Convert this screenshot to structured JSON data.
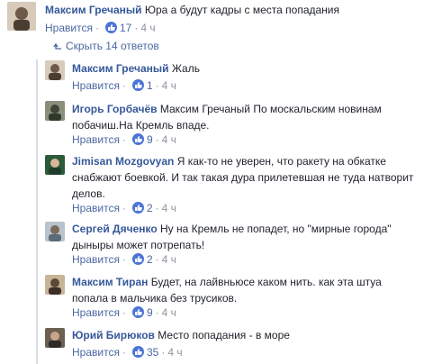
{
  "top_comment": {
    "author": "Максим Гречаный",
    "text": "Юра а будут кадры с места попадания",
    "like_label": "Нравится",
    "likes": "17",
    "time": "4 ч"
  },
  "hide_replies": {
    "label": "Скрыть 14 ответов"
  },
  "replies": [
    {
      "author": "Максим Гречаный",
      "text": "Жаль",
      "like_label": "Нравится",
      "likes": "1",
      "time": "4 ч"
    },
    {
      "author": "Игорь Горбачёв",
      "text_line1": "Максим Гречаный По москальским новинам",
      "text_line2": "побачиш.На Кремль впаде.",
      "like_label": "Нравится",
      "likes": "9",
      "time": "4 ч"
    },
    {
      "author": "Jimisan Mozgovyan",
      "text_line1": "Я как-то не уверен, что ракету на обкатке",
      "text_line2": "снабжают боевкой. И так такая дура прилетевшая не туда натворит",
      "text_line3": "делов.",
      "like_label": "Нравится",
      "likes": "2",
      "time": "4 ч"
    },
    {
      "author": "Сергей Дяченко",
      "text_line1": "Ну на Кремль не попадет, но \"мирные города\"",
      "text_line2": "дыныры может потрепать!",
      "like_label": "Нравится",
      "likes": "2",
      "time": "4 ч"
    },
    {
      "author": "Максим Тиран",
      "text_line1": "Будет, на лайвньюсе каком нить. как эта штуа",
      "text_line2": "попала в мальчика без трусиков.",
      "like_label": "Нравится",
      "likes": "9",
      "time": "4 ч"
    },
    {
      "author": "Юрий Бирюков",
      "text": "Место попадания - в море",
      "like_label": "Нравится",
      "likes": "35",
      "time": "4 ч"
    }
  ],
  "colors": {
    "link": "#365899",
    "meta": "#90949c",
    "like_blue": "#4c74d6",
    "text": "#1d2129"
  },
  "icons": {
    "like": "thumbs-up-icon",
    "collapse": "collapse-arrow-icon"
  }
}
